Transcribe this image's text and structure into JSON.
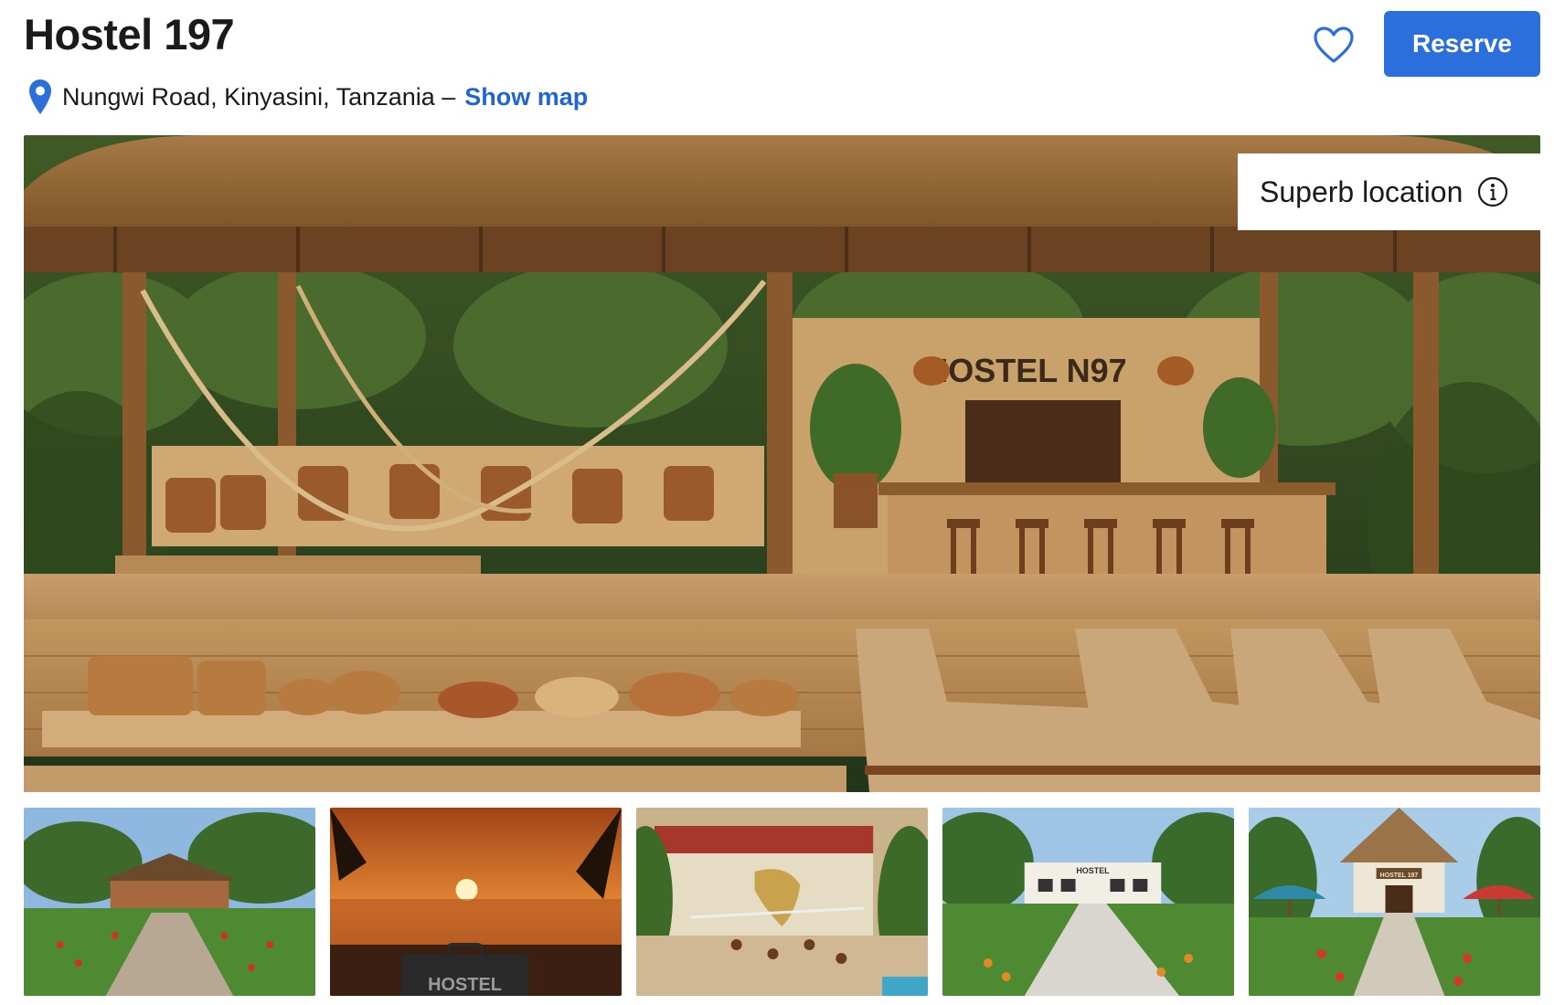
{
  "listing": {
    "title": "Hostel 197",
    "address": "Nungwi Road, Kinyasini, Tanzania –",
    "show_map_label": "Show map"
  },
  "actions": {
    "save_icon": "heart-icon",
    "reserve_label": "Reserve"
  },
  "hero": {
    "badge_label": "Superb location",
    "badge_icon": "info-icon",
    "sign_text": "HOSTEL N97"
  },
  "thumbnails": [
    {
      "scene": "bungalow-garden"
    },
    {
      "scene": "sunset-beach-suitcase",
      "suitcase_text": "HOSTEL"
    },
    {
      "scene": "volleyball-mural"
    },
    {
      "scene": "hostel-path",
      "sign_text": "HOSTEL"
    },
    {
      "scene": "thatched-entrance-umbrellas",
      "sign_text": "HOSTEL 197"
    }
  ],
  "colors": {
    "accent": "#2b6fdc",
    "link": "#1f66d1",
    "text": "#1a1a1a"
  }
}
